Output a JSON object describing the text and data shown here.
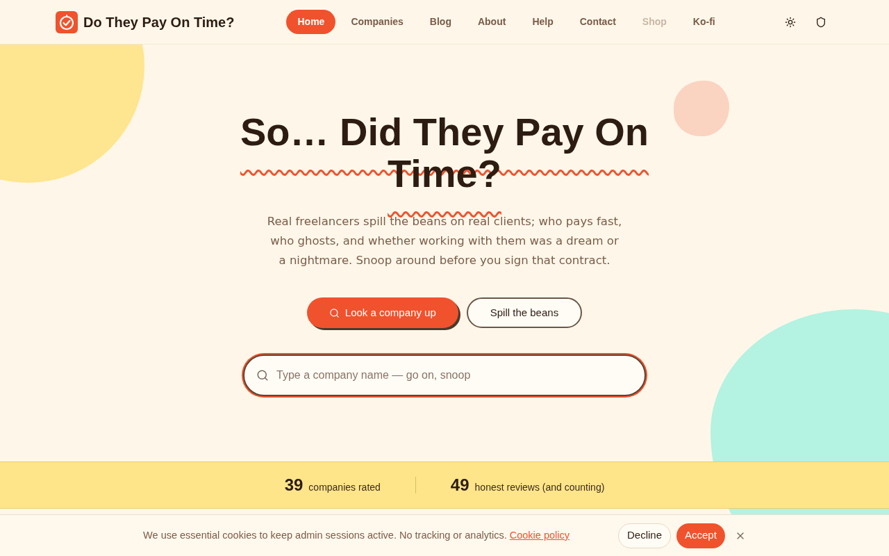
{
  "header": {
    "logo_text": "Do They Pay On Time?",
    "nav": [
      {
        "label": "Home",
        "selected": true,
        "disabled": false
      },
      {
        "label": "Companies",
        "selected": false,
        "disabled": false
      },
      {
        "label": "Blog",
        "selected": false,
        "disabled": false
      },
      {
        "label": "About",
        "selected": false,
        "disabled": false
      },
      {
        "label": "Help",
        "selected": false,
        "disabled": false
      },
      {
        "label": "Contact",
        "selected": false,
        "disabled": false
      },
      {
        "label": "Shop",
        "selected": false,
        "disabled": true
      },
      {
        "label": "Ko-fi",
        "selected": false,
        "disabled": false
      }
    ]
  },
  "hero": {
    "title": "So… Did They Pay On Time?",
    "subtitle": "Real freelancers spill the beans on real clients; who pays fast, who ghosts, and whether working with them was a dream or a nightmare. Snoop around before you sign that contract.",
    "buttons": [
      {
        "label": "Look a company up",
        "kind": "primary"
      },
      {
        "label": "Spill the beans",
        "kind": "secondary"
      }
    ],
    "search": {
      "placeholder": "Type a company name — go on, snoop"
    }
  },
  "stats": [
    {
      "value": "39",
      "label": "companies rated"
    },
    {
      "value": "49",
      "label": "honest reviews (and counting)"
    }
  ],
  "cookie_banner": {
    "message": "We use essential cookies to keep admin sessions active. No tracking or analytics.",
    "link": "Cookie policy",
    "buttons": [
      {
        "label": "Decline",
        "kind": "secondary"
      },
      {
        "label": "Accept",
        "kind": "primary"
      }
    ]
  }
}
